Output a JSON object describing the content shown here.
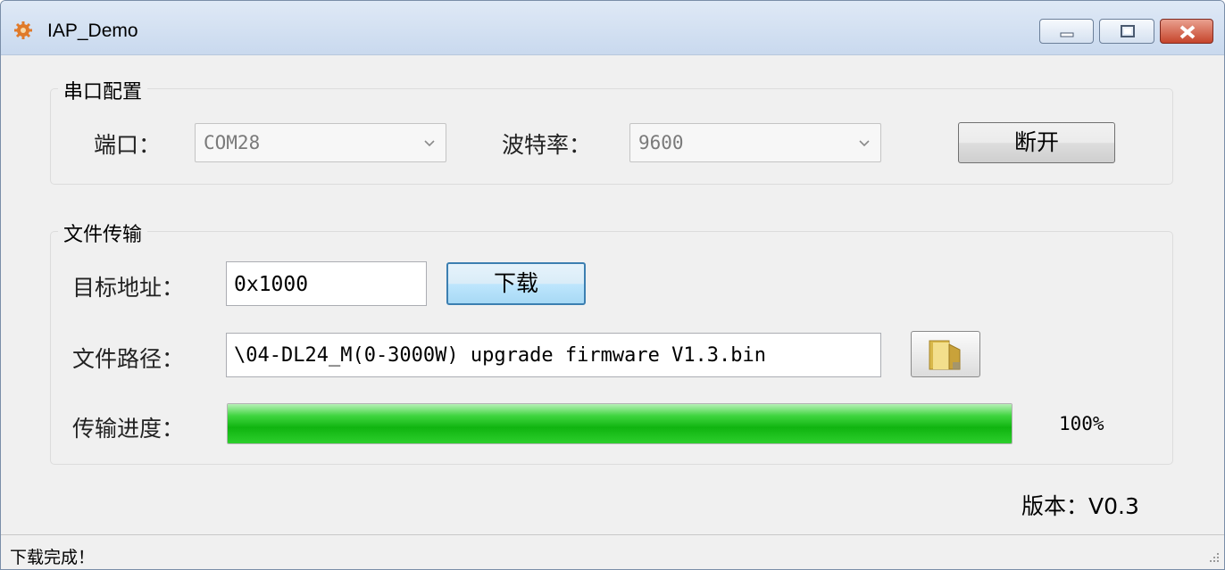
{
  "window": {
    "title": "IAP_Demo",
    "icon": "gear-icon",
    "controls": [
      "minimize-icon",
      "maximize-icon",
      "close-icon"
    ]
  },
  "serial": {
    "group_label": "串口配置",
    "port_label": "端口：",
    "port_value": "COM28",
    "baud_label": "波特率：",
    "baud_value": "9600",
    "disconnect_label": "断开"
  },
  "transfer": {
    "group_label": "文件传输",
    "address_label": "目标地址：",
    "address_value": "0x1000",
    "download_label": "下载",
    "path_label": "文件路径：",
    "path_value": "\\04-DL24_M(0-3000W) upgrade firmware V1.3.bin",
    "browse_icon": "folder-icon",
    "progress_label": "传输进度：",
    "progress_fraction": 1.0,
    "progress_text": "100%"
  },
  "version": "版本：V0.3",
  "status": "下载完成！",
  "colors": {
    "progress_green": "#10b410",
    "close_red": "#c6452c",
    "titlebar": "#c9d9ee"
  }
}
